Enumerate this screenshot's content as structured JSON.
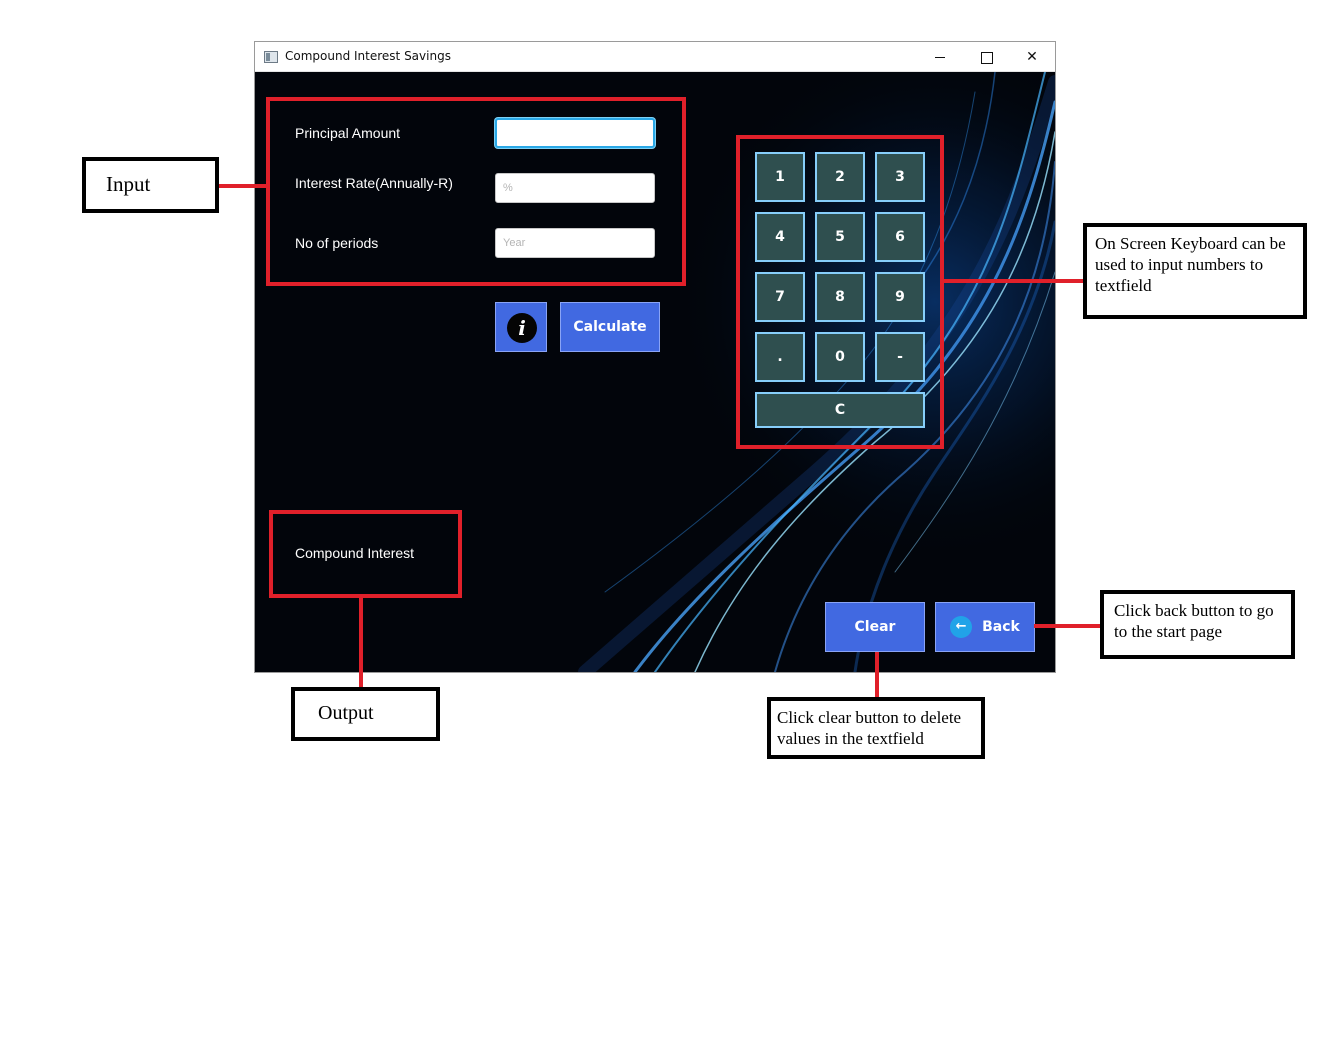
{
  "window": {
    "title": "Compound Interest Savings",
    "controls": {
      "minimize": "",
      "maximize": "",
      "close": "✕"
    }
  },
  "form": {
    "principal_label": "Principal Amount",
    "principal_value": "",
    "rate_label": "Interest Rate(Annually-R)",
    "rate_placeholder": "%",
    "periods_label": "No of periods",
    "periods_placeholder": "Year",
    "info_button": "i",
    "calculate_button": "Calculate"
  },
  "keypad": {
    "keys": [
      "1",
      "2",
      "3",
      "4",
      "5",
      "6",
      "7",
      "8",
      "9",
      ".",
      "0",
      "-"
    ],
    "clear_key": "C"
  },
  "output": {
    "label": "Compound Interest"
  },
  "footer": {
    "clear_button": "Clear",
    "back_button": "Back",
    "back_icon": "←"
  },
  "annotations": {
    "input": "Input",
    "output": "Output",
    "keyboard": "On Screen Keyboard can be used to input numbers to textfield",
    "back": "Click back button to go to the start page",
    "clear": "Click clear button to delete values in the textfield"
  },
  "colors": {
    "button_blue": "#4169e1",
    "key_fill": "#2f4f4f",
    "key_border": "#87cefa",
    "annotation_red": "#e0202a"
  }
}
